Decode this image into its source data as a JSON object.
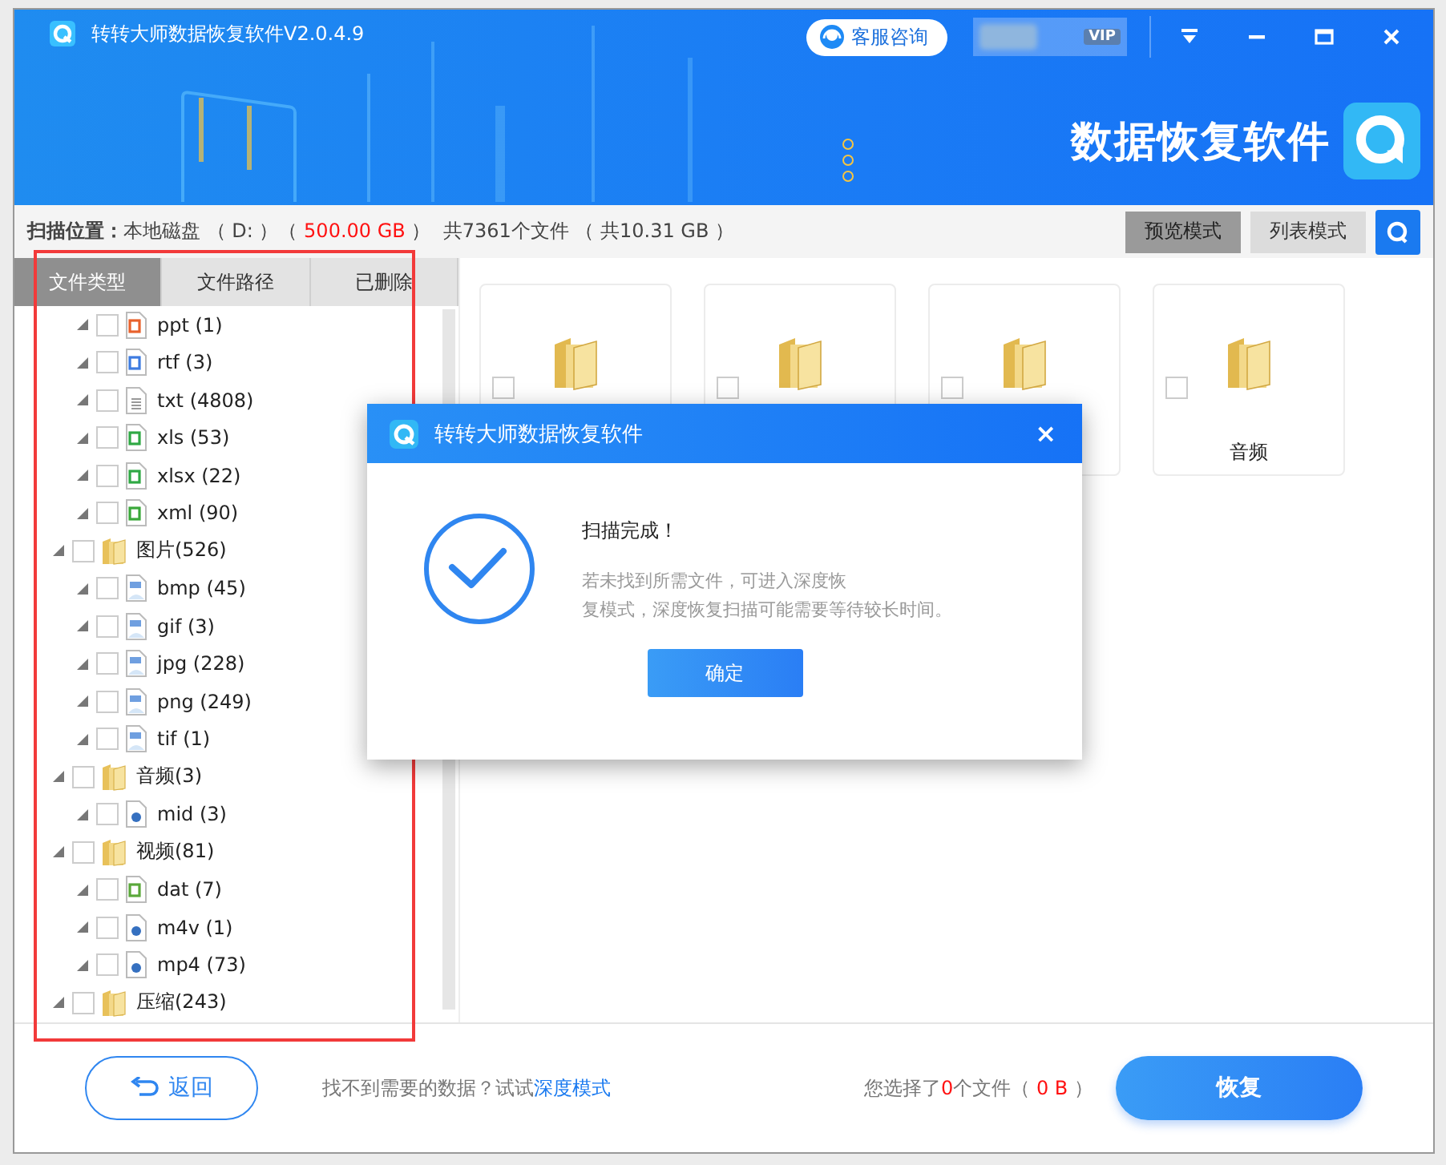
{
  "window": {
    "title": "转转大师数据恢复软件V2.0.4.9",
    "service_button": "客服咨询",
    "vip_badge": "VIP",
    "banner_title": "数据恢复软件"
  },
  "scan_info": {
    "label": "扫描位置：",
    "location": "本地磁盘 （ D: ）（ ",
    "size": "500.00 GB",
    "summary": " ）  共7361个文件 （ 共10.31 GB ）"
  },
  "view_modes": [
    {
      "label": "预览模式",
      "selected": true
    },
    {
      "label": "列表模式",
      "selected": false
    }
  ],
  "tabs": [
    {
      "label": "文件类型",
      "selected": true
    },
    {
      "label": "文件路径",
      "selected": false
    },
    {
      "label": "已删除",
      "selected": false
    }
  ],
  "tree": [
    {
      "children": [
        {
          "label": "ppt (1)",
          "kind": "ppt",
          "checked": false
        },
        {
          "label": "rtf (3)",
          "kind": "word",
          "checked": false
        },
        {
          "label": "txt (4808)",
          "kind": "text",
          "checked": false
        },
        {
          "label": "xls (53)",
          "kind": "sheet",
          "checked": false
        },
        {
          "label": "xlsx (22)",
          "kind": "sheet",
          "checked": false
        },
        {
          "label": "xml (90)",
          "kind": "xml",
          "checked": false
        }
      ]
    },
    {
      "label": "图片(526)",
      "checked": false,
      "children": [
        {
          "label": "bmp (45)",
          "kind": "image",
          "checked": false
        },
        {
          "label": "gif (3)",
          "kind": "image",
          "checked": false
        },
        {
          "label": "jpg (228)",
          "kind": "image",
          "checked": false
        },
        {
          "label": "png (249)",
          "kind": "image",
          "checked": false
        },
        {
          "label": "tif (1)",
          "kind": "image",
          "checked": false
        }
      ]
    },
    {
      "label": "音频(3)",
      "checked": false,
      "children": [
        {
          "label": "mid (3)",
          "kind": "media",
          "checked": false
        }
      ]
    },
    {
      "label": "视频(81)",
      "checked": false,
      "children": [
        {
          "label": "dat (7)",
          "kind": "dat",
          "checked": false
        },
        {
          "label": "m4v (1)",
          "kind": "media",
          "checked": false
        },
        {
          "label": "mp4 (73)",
          "kind": "media",
          "checked": false
        }
      ]
    },
    {
      "label": "压缩(243)",
      "checked": false
    }
  ],
  "folders": [
    {
      "checked": false
    },
    {
      "checked": false
    },
    {
      "checked": false
    },
    {
      "label": "音频",
      "checked": false
    }
  ],
  "dialog": {
    "title": "转转大师数据恢复软件",
    "close": "×",
    "heading": "扫描完成！",
    "message_lines": [
      "若未找到所需文件，可进入深度恢",
      "复模式，深度恢复扫描可能需要等待较长时间。"
    ],
    "ok_button": "确定"
  },
  "footer": {
    "back_button": "返回",
    "hint": "找不到需要的数据？试试",
    "hint_link": "深度模式",
    "selection_prefix": "您选择了",
    "selection_count": "0",
    "selection_middle": "个文件（ ",
    "selection_size": "0 B",
    "selection_suffix": " ）",
    "recover_button": "恢复"
  }
}
